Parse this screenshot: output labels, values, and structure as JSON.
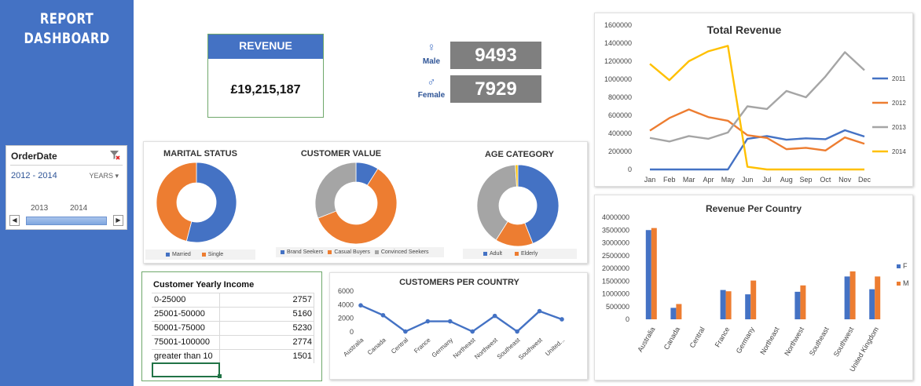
{
  "sidebar": {
    "title_line1": "REPORT",
    "title_line2": "DASHBOARD"
  },
  "slicer": {
    "header": "OrderDate",
    "range": "2012 - 2014",
    "level": "YEARS",
    "years": [
      "2013",
      "2014"
    ],
    "left_arrow": "◀",
    "right_arrow": "▶"
  },
  "revenue": {
    "label": "REVENUE",
    "value": "£19,215,187"
  },
  "gender": {
    "male_symbol": "♀",
    "male_label": "Male",
    "male_value": "9493",
    "female_symbol": "♂",
    "female_label": "Female",
    "female_value": "7929"
  },
  "colors": {
    "blue": "#4472c4",
    "orange": "#ed7d31",
    "gray": "#a5a5a5",
    "yellow": "#ffc000"
  },
  "marital": {
    "title": "MARITAL STATUS",
    "legend": [
      {
        "label": "Married",
        "color": "#4472c4"
      },
      {
        "label": "Single",
        "color": "#ed7d31"
      }
    ],
    "values": [
      54,
      46
    ]
  },
  "customer_value": {
    "title": "CUSTOMER VALUE",
    "legend": [
      {
        "label": "Brand Seekers",
        "color": "#4472c4"
      },
      {
        "label": "Casual Buyers",
        "color": "#ed7d31"
      },
      {
        "label": "Convinced Seekers",
        "color": "#a5a5a5"
      }
    ],
    "values": [
      9,
      60,
      31
    ]
  },
  "age": {
    "title": "AGE CATEGORY",
    "legend": [
      {
        "label": "Adult",
        "color": "#4472c4"
      },
      {
        "label": "Elderly",
        "color": "#ed7d31"
      }
    ],
    "values": [
      44,
      15,
      40,
      1
    ],
    "colors": [
      "#4472c4",
      "#ed7d31",
      "#a5a5a5",
      "#ffc000"
    ]
  },
  "income": {
    "title": "Customer Yearly Income",
    "rows": [
      {
        "range": "0-25000",
        "count": "2757"
      },
      {
        "range": "25001-50000",
        "count": "5160"
      },
      {
        "range": "50001-75000",
        "count": "5230"
      },
      {
        "range": "75001-100000",
        "count": "2774"
      },
      {
        "range": "greater than 10",
        "count": "1501"
      }
    ]
  },
  "chart_data": [
    {
      "type": "line",
      "title": "Total Revenue",
      "x": [
        "Jan",
        "Feb",
        "Mar",
        "Apr",
        "May",
        "Jun",
        "Jul",
        "Aug",
        "Sep",
        "Oct",
        "Nov",
        "Dec"
      ],
      "ylim": [
        0,
        1600000
      ],
      "yticks": [
        "0",
        "200000",
        "400000",
        "600000",
        "800000",
        "1000000",
        "1200000",
        "1400000",
        "1600000"
      ],
      "legend_position": "right",
      "series": [
        {
          "name": "2011",
          "color": "#4472c4",
          "values": [
            0,
            0,
            0,
            0,
            0,
            340000,
            370000,
            330000,
            345000,
            335000,
            435000,
            365000
          ]
        },
        {
          "name": "2012",
          "color": "#ed7d31",
          "values": [
            430000,
            570000,
            665000,
            580000,
            540000,
            380000,
            350000,
            225000,
            240000,
            210000,
            355000,
            285000
          ]
        },
        {
          "name": "2013",
          "color": "#a5a5a5",
          "values": [
            350000,
            310000,
            370000,
            340000,
            410000,
            700000,
            670000,
            870000,
            800000,
            1030000,
            1300000,
            1100000
          ]
        },
        {
          "name": "2014",
          "color": "#ffc000",
          "values": [
            1170000,
            990000,
            1200000,
            1310000,
            1370000,
            30000,
            0,
            0,
            0,
            0,
            0,
            0
          ]
        }
      ]
    },
    {
      "type": "line",
      "title": "CUSTOMERS PER COUNTRY",
      "x": [
        "Australia",
        "Canada",
        "Central",
        "France",
        "Germany",
        "Northeast",
        "Northwest",
        "Southeast",
        "Southwest",
        "United..."
      ],
      "ylim": [
        0,
        6000
      ],
      "yticks": [
        "0",
        "2000",
        "4000",
        "6000"
      ],
      "series": [
        {
          "color": "#4472c4",
          "values": [
            3900,
            2450,
            50,
            1550,
            1550,
            50,
            2350,
            50,
            3050,
            1850
          ]
        }
      ]
    },
    {
      "type": "bar",
      "title": "Revenue Per Country",
      "categories": [
        "Australia",
        "Canada",
        "Central",
        "France",
        "Germany",
        "Northeast",
        "Northwest",
        "Southeast",
        "Southwest",
        "United Kingdom"
      ],
      "ylim": [
        0,
        4000000
      ],
      "yticks": [
        "0",
        "500000",
        "1000000",
        "1500000",
        "2000000",
        "2500000",
        "3000000",
        "3500000",
        "4000000"
      ],
      "legend_position": "right",
      "series": [
        {
          "name": "F",
          "color": "#4472c4",
          "values": [
            3500000,
            450000,
            0,
            1150000,
            980000,
            0,
            1080000,
            0,
            1680000,
            1180000
          ]
        },
        {
          "name": "M",
          "color": "#ed7d31",
          "values": [
            3580000,
            600000,
            0,
            1100000,
            1520000,
            0,
            1330000,
            0,
            1880000,
            1680000
          ]
        }
      ]
    }
  ]
}
